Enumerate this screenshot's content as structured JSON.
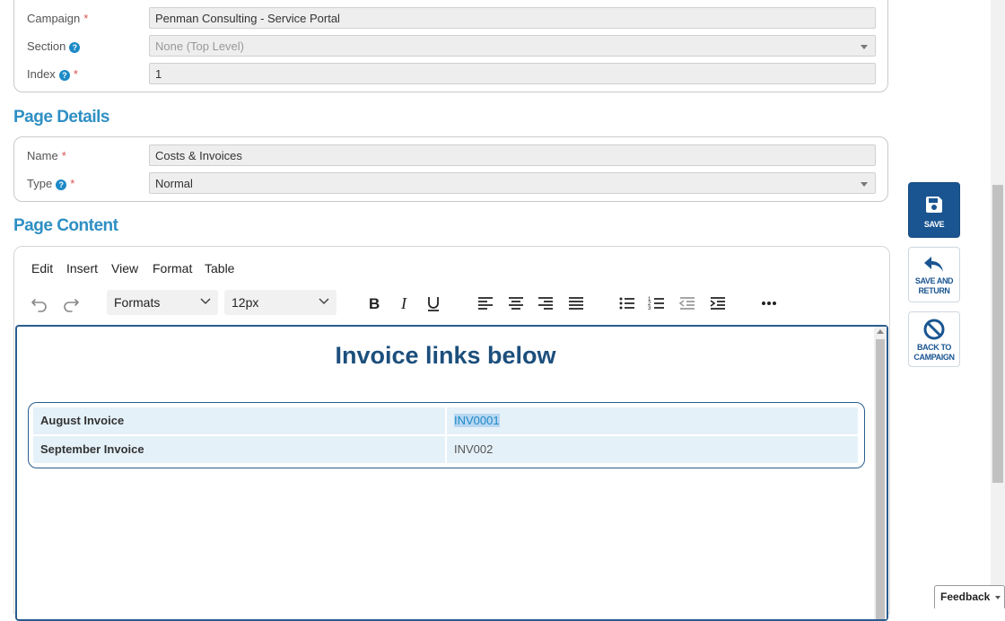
{
  "campaign_section": {
    "campaign": {
      "label": "Campaign",
      "value": "Penman Consulting - Service Portal"
    },
    "section": {
      "label": "Section",
      "value": "None (Top Level)"
    },
    "index": {
      "label": "Index",
      "value": "1"
    }
  },
  "page_details": {
    "title": "Page Details",
    "name": {
      "label": "Name",
      "value": "Costs & Invoices"
    },
    "type": {
      "label": "Type",
      "value": "Normal"
    }
  },
  "page_content": {
    "title": "Page Content",
    "menu": [
      "Edit",
      "Insert",
      "View",
      "Format",
      "Table"
    ],
    "toolbar": {
      "formats": "Formats",
      "font_size": "12px",
      "icons": [
        "undo-icon",
        "redo-icon",
        "bold-icon",
        "italic-icon",
        "underline-icon",
        "align-left-icon",
        "align-center-icon",
        "align-right-icon",
        "align-justify-icon",
        "bullet-list-icon",
        "numbered-list-icon",
        "outdent-icon",
        "indent-icon",
        "more-icon"
      ]
    },
    "heading": "Invoice links below",
    "table": [
      {
        "label": "August Invoice",
        "value": "INV0001"
      },
      {
        "label": "September Invoice",
        "value": "INV002"
      }
    ]
  },
  "actions": {
    "save": {
      "line1": "SAVE"
    },
    "save_return": {
      "line1": "SAVE AND",
      "line2": "RETURN"
    },
    "back": {
      "line1": "BACK TO",
      "line2": "CAMPAIGN"
    }
  },
  "feedback": "Feedback",
  "colors": {
    "accent": "#2f8fc4",
    "primary_button": "#1a5591",
    "required": "#d9534f"
  }
}
